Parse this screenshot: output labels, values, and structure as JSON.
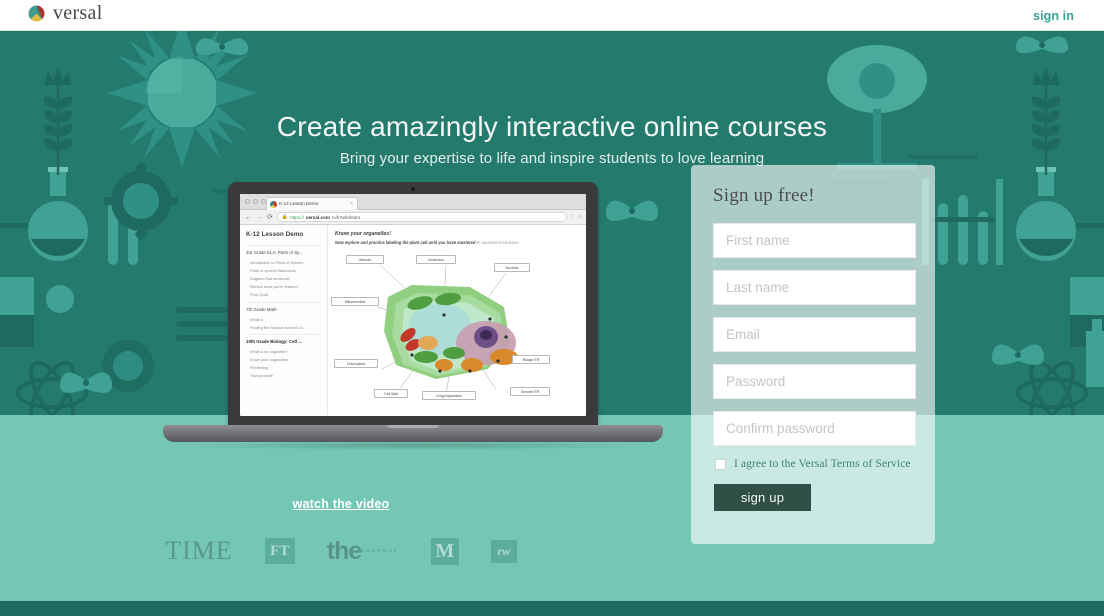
{
  "nav": {
    "logo_text": "versal",
    "logo_icon": "versal-circle-logo-icon",
    "signin_label": "sign in"
  },
  "hero": {
    "headline": "Create amazingly interactive online courses",
    "subheadline": "Bring your expertise to life and inspire students to love learning",
    "watch_video_label": "watch the video",
    "background_color": "#257a6e",
    "band_color": "#74c6b5",
    "footer_color": "#1f6b60"
  },
  "press_logos": [
    {
      "name": "TIME",
      "label": "TIME"
    },
    {
      "name": "FT",
      "label": "FT"
    },
    {
      "name": "the-journal",
      "label": "the",
      "sub": "JOURNAL"
    },
    {
      "name": "medium",
      "label": "M"
    },
    {
      "name": "readwrite",
      "label": "rw"
    }
  ],
  "laptop": {
    "browser": {
      "tab_title": "K-12 Lesson Demo",
      "tab_close": "×",
      "back_icon": "←",
      "forward_icon": "→",
      "reload_icon": "⟳",
      "lock_icon": "🔒",
      "url_scheme": "https://",
      "url_host": "versal.com",
      "url_path": "/c/k7wfe/learn",
      "star_icon": "☆",
      "menu_icon": "≡"
    },
    "course": {
      "title": "K-12 Lesson Demo",
      "sections": [
        {
          "title": "3rd Grade ELA: Parts of Sp...",
          "bold": false,
          "items": [
            "Introduction to Parts of Speech",
            "Parts of speech flashcards",
            "Diagram that sentence!",
            "Review what you're learned",
            "Final Quiz!"
          ]
        },
        {
          "title": "7th Grade Math",
          "bold": false,
          "items": [
            "What is",
            "Finding the Surface Area of Co..."
          ]
        },
        {
          "title": "10th Grade Biology: Cell ...",
          "bold": true,
          "items": [
            "What is an organelle?",
            "Know your organelles!",
            "Reviewing",
            "Test yourself!"
          ]
        }
      ],
      "lesson_heading": "Know your organelles!",
      "lesson_text_bold": "Now explore and practice labeling the plant cell until you have mastered",
      "lesson_text_rest": " its anatomical structure.",
      "cell_labels": [
        "Vacuole",
        "Nucleolus",
        "Nucleus",
        "Mitochondria",
        "Chloroplast",
        "Cell Wall",
        "Golgi Apparatus",
        "Rough ER",
        "Smooth ER"
      ]
    }
  },
  "signup": {
    "title": "Sign up free!",
    "fields": [
      {
        "name": "first-name",
        "placeholder": "First name",
        "value": ""
      },
      {
        "name": "last-name",
        "placeholder": "Last name",
        "value": ""
      },
      {
        "name": "email",
        "placeholder": "Email",
        "value": ""
      },
      {
        "name": "password",
        "placeholder": "Password",
        "value": ""
      },
      {
        "name": "confirm-password",
        "placeholder": "Confirm password",
        "value": ""
      }
    ],
    "terms_label": "I agree to the Versal Terms of Service",
    "terms_checked": false,
    "submit_label": "sign up",
    "submit_color": "#2f4f47"
  }
}
